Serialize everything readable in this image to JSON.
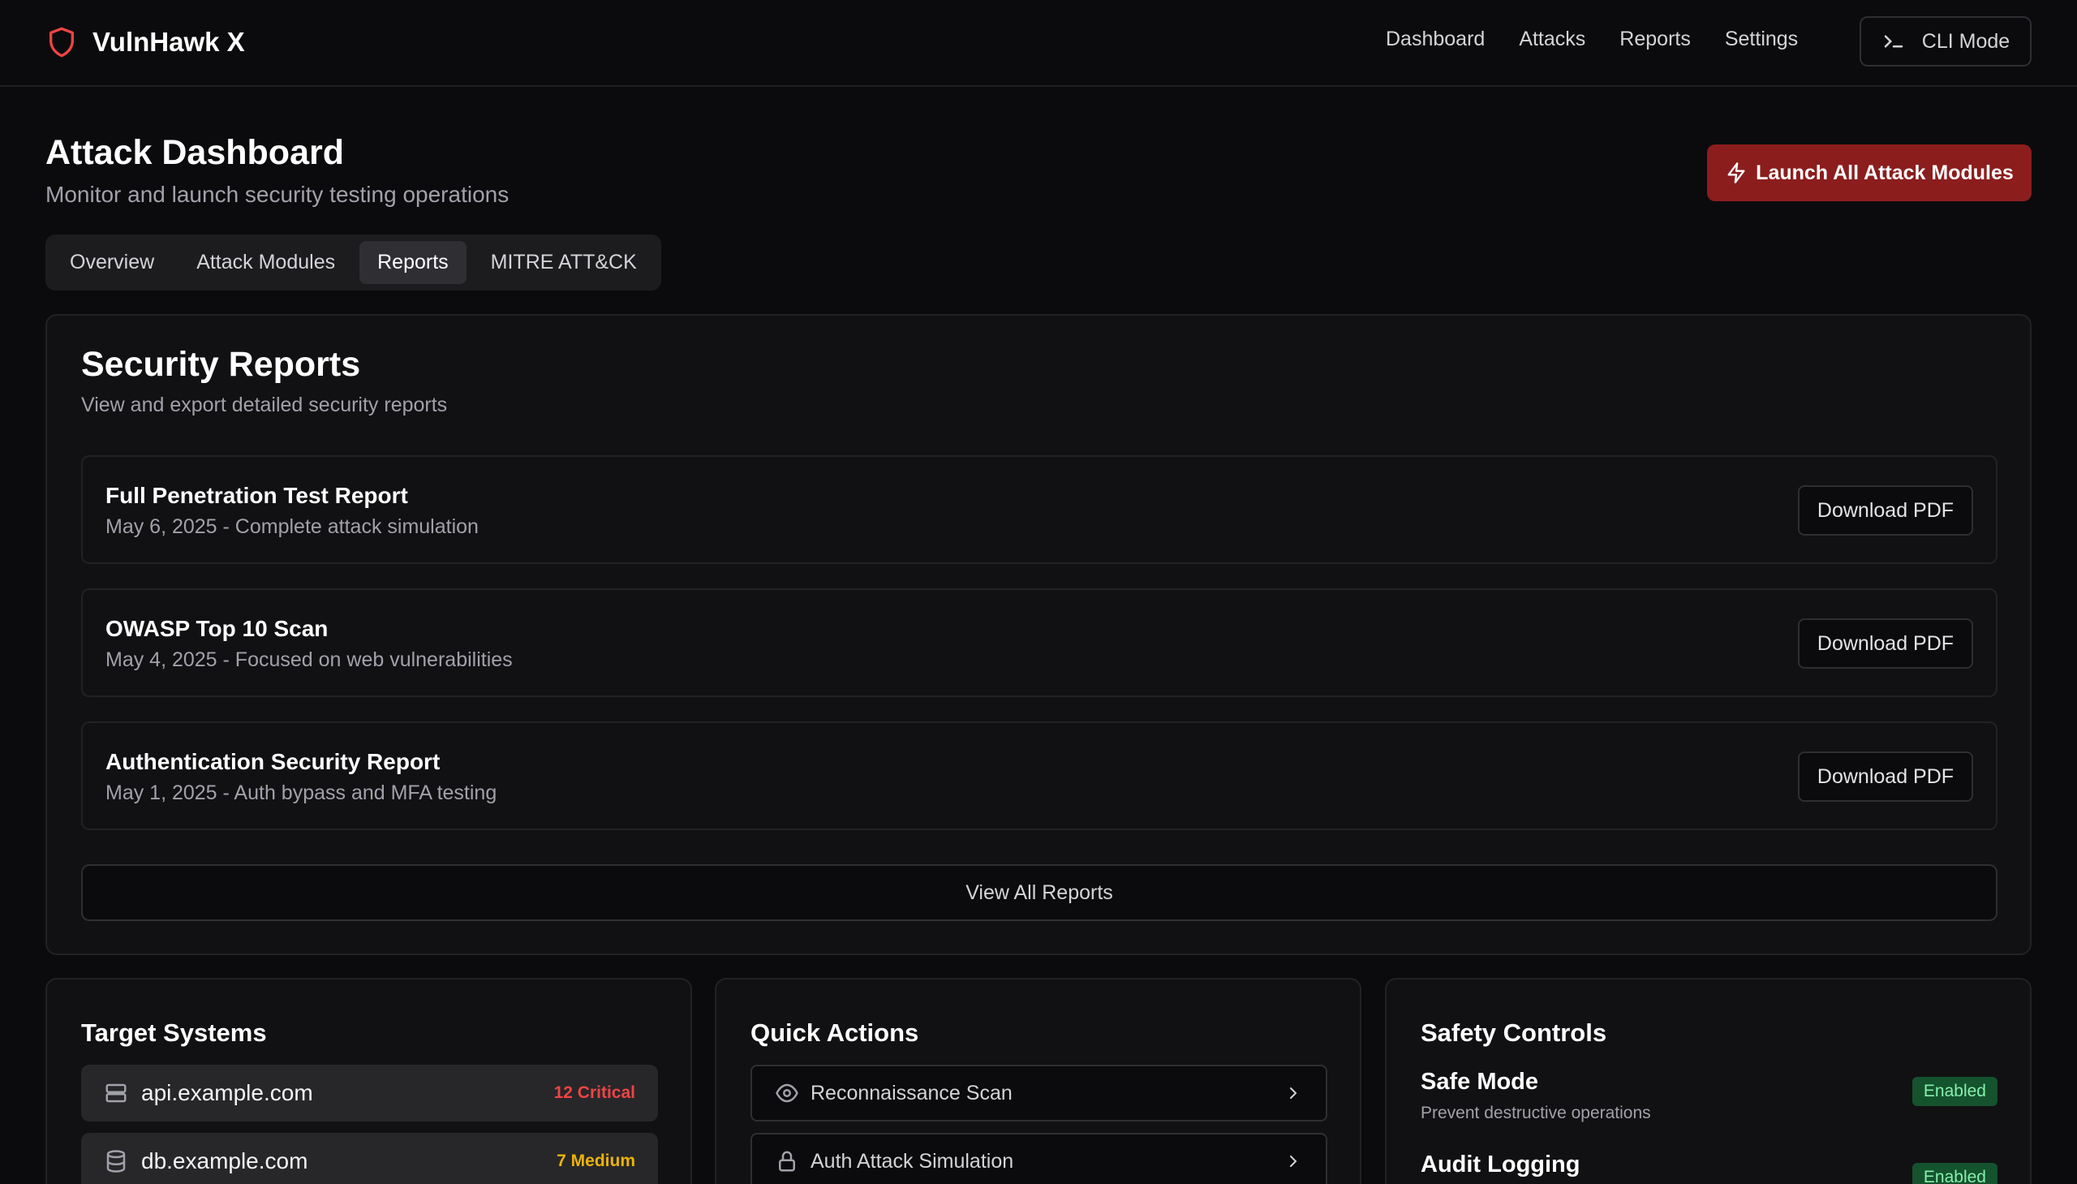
{
  "app": {
    "name": "VulnHawk X"
  },
  "nav": {
    "links": [
      "Dashboard",
      "Attacks",
      "Reports",
      "Settings"
    ],
    "cli_label": "CLI Mode"
  },
  "header": {
    "title": "Attack Dashboard",
    "subtitle": "Monitor and launch security testing operations",
    "launch_label": "Launch All Attack Modules"
  },
  "tabs": [
    {
      "label": "Overview",
      "active": false
    },
    {
      "label": "Attack Modules",
      "active": false
    },
    {
      "label": "Reports",
      "active": true
    },
    {
      "label": "MITRE ATT&CK",
      "active": false
    }
  ],
  "reports": {
    "title": "Security Reports",
    "subtitle": "View and export detailed security reports",
    "items": [
      {
        "name": "Full Penetration Test Report",
        "desc": "May 6, 2025 - Complete attack simulation",
        "action": "Download PDF"
      },
      {
        "name": "OWASP Top 10 Scan",
        "desc": "May 4, 2025 - Focused on web vulnerabilities",
        "action": "Download PDF"
      },
      {
        "name": "Authentication Security Report",
        "desc": "May 1, 2025 - Auth bypass and MFA testing",
        "action": "Download PDF"
      }
    ],
    "view_all": "View All Reports"
  },
  "targets": {
    "title": "Target Systems",
    "items": [
      {
        "host": "api.example.com",
        "badge": "12 Critical",
        "badge_color": "#ef4444",
        "icon": "server-icon"
      },
      {
        "host": "db.example.com",
        "badge": "7 Medium",
        "badge_color": "#eab308",
        "icon": "database-icon"
      }
    ]
  },
  "quick_actions": {
    "title": "Quick Actions",
    "items": [
      {
        "label": "Reconnaissance Scan",
        "icon": "eye-icon"
      },
      {
        "label": "Auth Attack Simulation",
        "icon": "lock-icon"
      }
    ]
  },
  "safety": {
    "title": "Safety Controls",
    "items": [
      {
        "name": "Safe Mode",
        "desc": "Prevent destructive operations",
        "status": "Enabled"
      },
      {
        "name": "Audit Logging",
        "desc": "",
        "status": "Enabled"
      }
    ]
  },
  "colors": {
    "accent_red": "#8b1d1d",
    "critical": "#ef4444",
    "medium": "#eab308",
    "enabled_bg": "#14532d",
    "enabled_fg": "#86efac"
  }
}
